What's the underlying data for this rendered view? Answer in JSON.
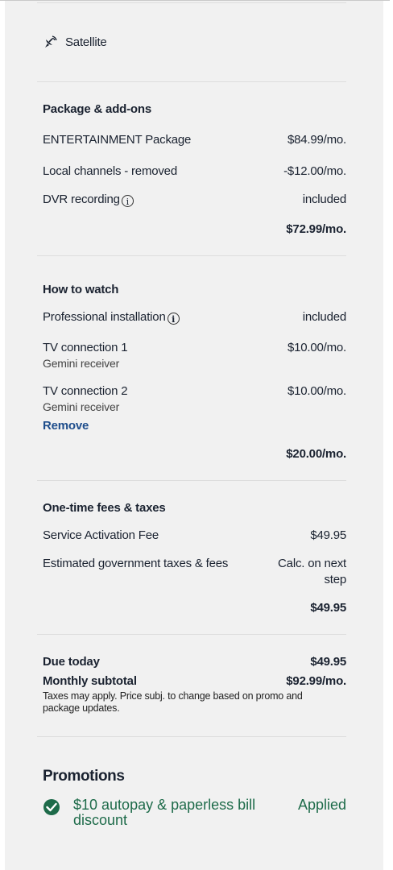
{
  "service": {
    "label": "Satellite"
  },
  "package": {
    "heading": "Package & add-ons",
    "rows": [
      {
        "label": "ENTERTAINMENT Package",
        "value": "$84.99/mo."
      },
      {
        "label": "Local channels - removed",
        "value": "-$12.00/mo."
      },
      {
        "label": "DVR recording",
        "value": "included"
      }
    ],
    "total": "$72.99/mo."
  },
  "watch": {
    "heading": "How to watch",
    "install_label": "Professional installation",
    "install_value": "included",
    "tv1_label": "TV connection 1",
    "tv1_sub": "Gemini receiver",
    "tv1_value": "$10.00/mo.",
    "tv2_label": "TV connection 2",
    "tv2_sub": "Gemini receiver",
    "tv2_value": "$10.00/mo.",
    "remove_label": "Remove",
    "total": "$20.00/mo."
  },
  "fees": {
    "heading": "One-time fees & taxes",
    "activation_label": "Service Activation Fee",
    "activation_value": "$49.95",
    "taxes_label": "Estimated government taxes & fees",
    "taxes_value_1": "Calc. on next",
    "taxes_value_2": "step",
    "total": "$49.95"
  },
  "summary": {
    "due_today_label": "Due today",
    "due_today_value": "$49.95",
    "monthly_label": "Monthly subtotal",
    "monthly_value": "$92.99/mo.",
    "disclaimer": "Taxes may apply. Price subj. to change based on promo and package updates."
  },
  "promotions": {
    "heading": "Promotions",
    "items": [
      {
        "text": "$10 autopay & paperless bill discount",
        "status": "Applied"
      }
    ]
  },
  "colors": {
    "promo_green": "#1e6b4a",
    "link_blue": "#1f4e8c",
    "panel_bg": "#f1f1f1"
  },
  "icons": {
    "service": "satellite-dish-icon",
    "info": "info-icon",
    "promo": "check-circle-icon"
  }
}
